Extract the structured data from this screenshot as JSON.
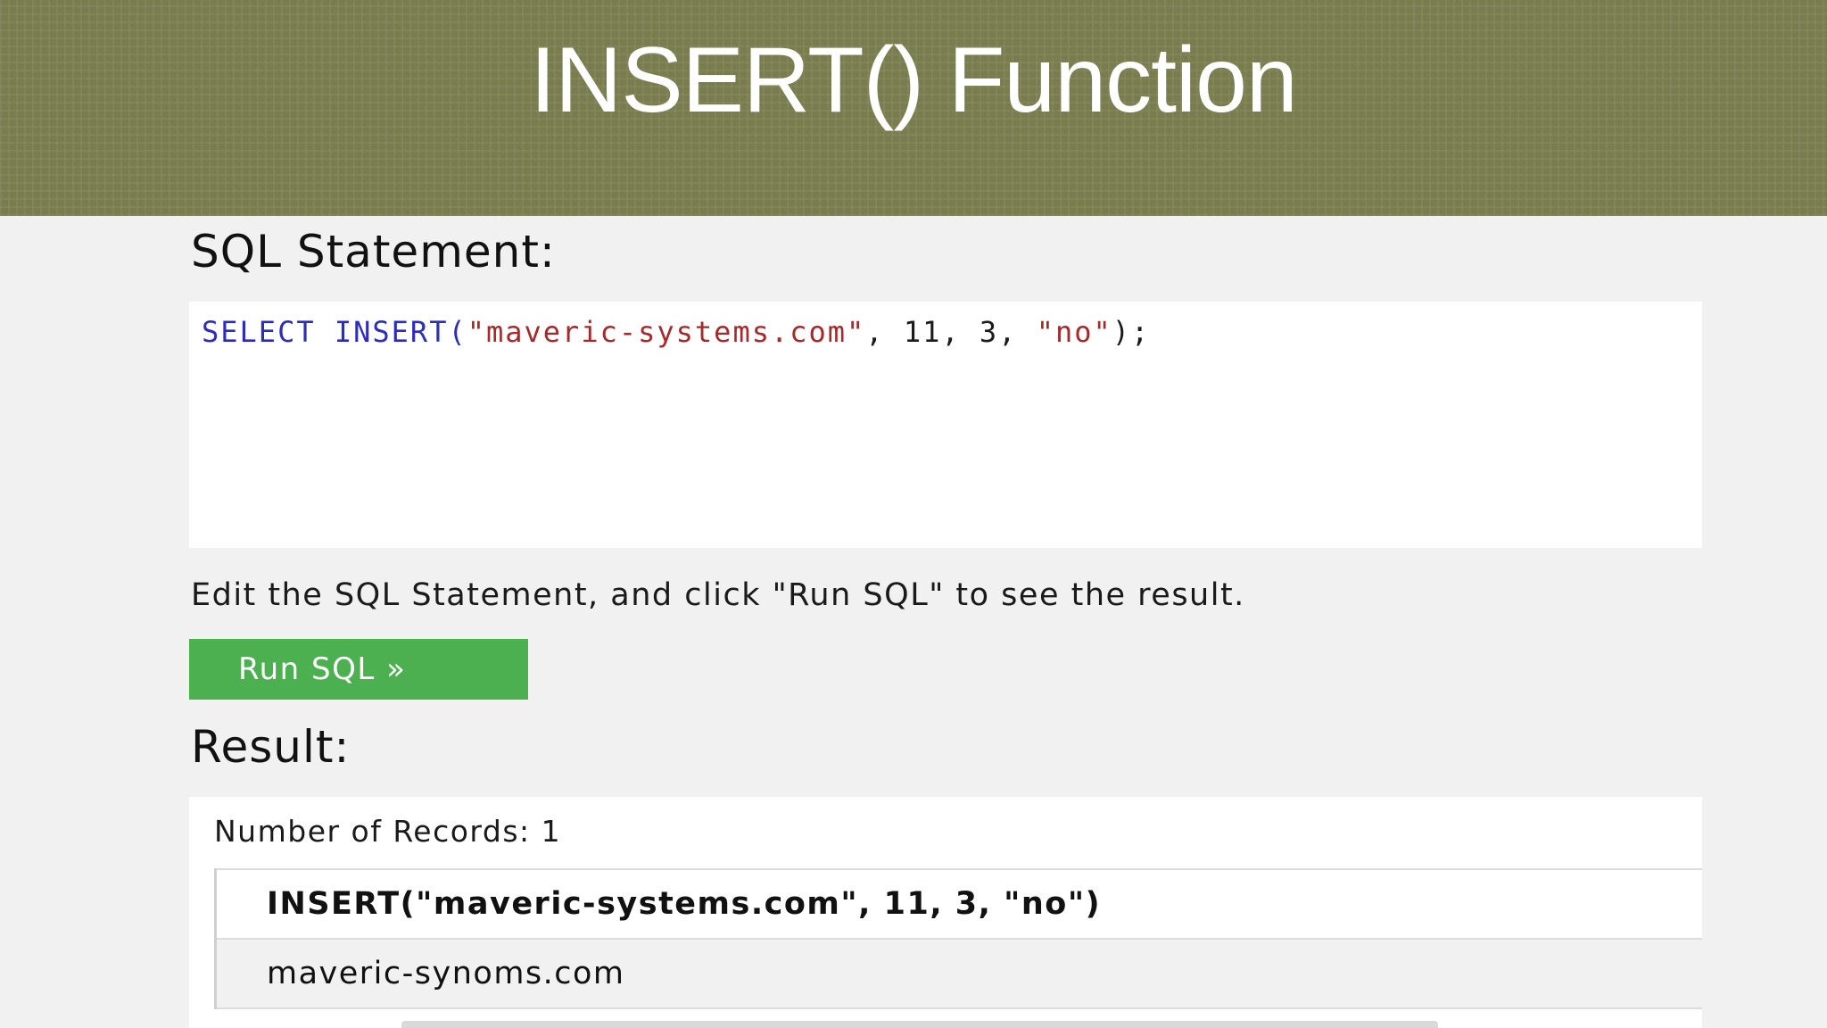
{
  "slide": {
    "title": "INSERT() Function"
  },
  "editor": {
    "heading": "SQL Statement:",
    "code_tokens": {
      "select": "SELECT",
      "insert": "INSERT(",
      "arg1": "\"maveric-systems.com\"",
      "sep1": ", 11, 3, ",
      "arg4": "\"no\"",
      "end": ");"
    },
    "instruction": "Edit the SQL Statement, and click \"Run SQL\" to see the result.",
    "run_button_label": "Run SQL »"
  },
  "result": {
    "heading": "Result:",
    "record_count_text": "Number of Records: 1",
    "column_header": "INSERT(\"maveric-systems.com\", 11, 3, \"no\")",
    "rows": [
      "maveric-synoms.com"
    ]
  },
  "colors": {
    "header_band": "#7a7e4f",
    "run_button": "#4caf50",
    "keyword": "#2d2dbb",
    "string": "#a52a2a"
  }
}
